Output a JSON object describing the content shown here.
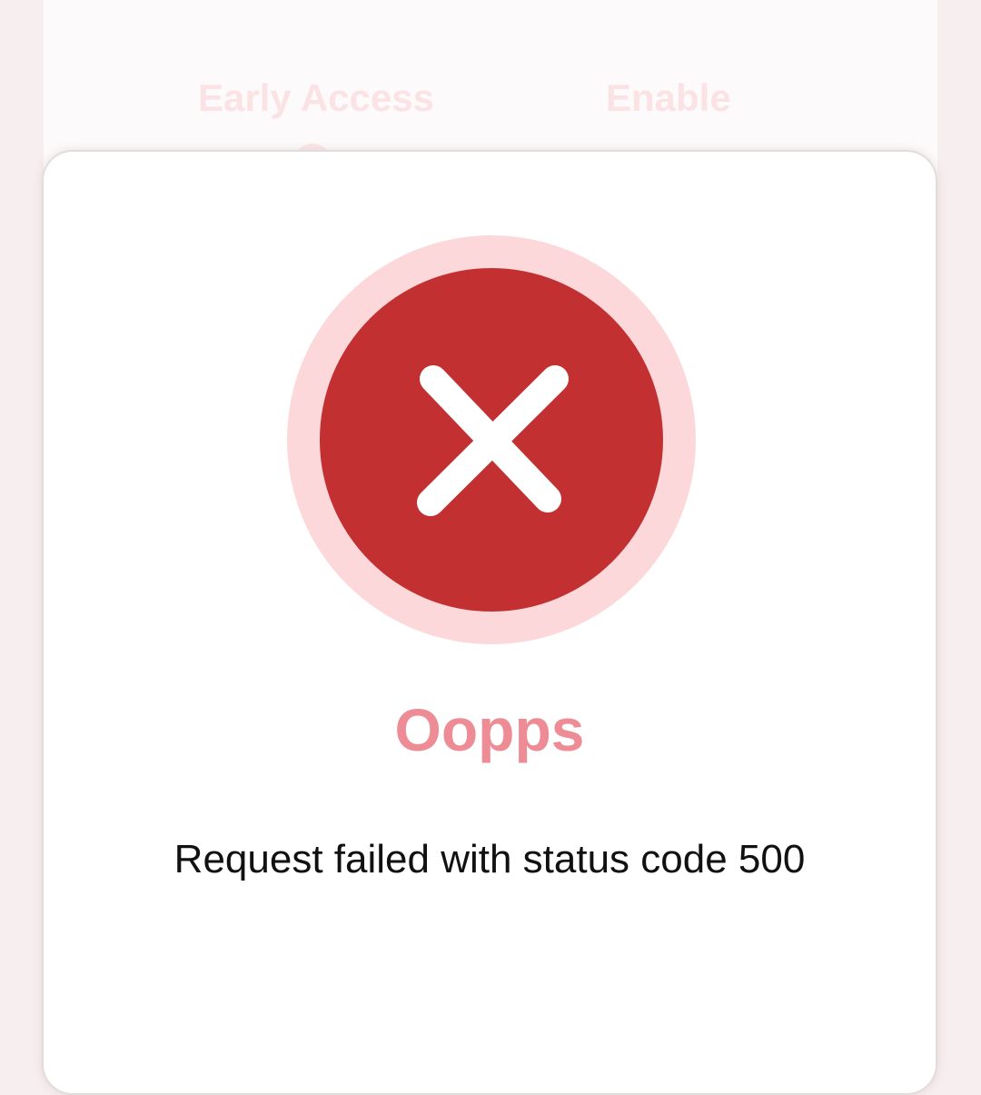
{
  "background": {
    "tabs": [
      {
        "label": "Early Access"
      },
      {
        "label": "Enable"
      }
    ]
  },
  "dialog": {
    "icon": "close-icon",
    "title": "Oopps",
    "message": "Request failed with status code 500"
  },
  "colors": {
    "error_red": "#c33032",
    "halo_pink": "#fdd8da",
    "title_pink": "#ee8c96"
  }
}
